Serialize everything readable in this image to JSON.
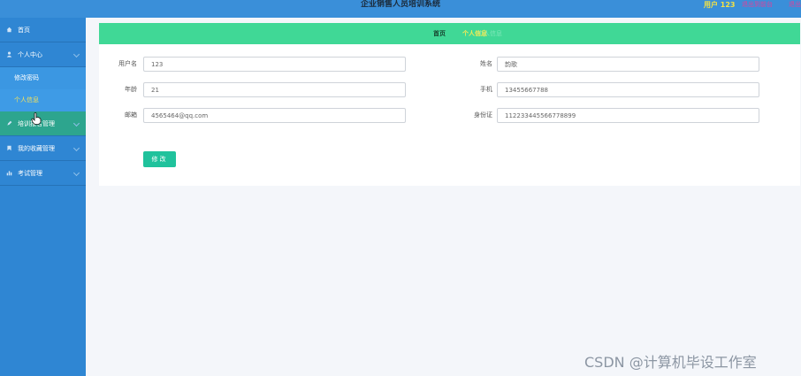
{
  "header": {
    "title": "企业销售人员培训系统",
    "user": "用户 123",
    "exit_link": "退出到前台",
    "logout_link": "退出"
  },
  "sidebar": {
    "items": [
      {
        "label": "首页",
        "icon": "home-icon"
      },
      {
        "label": "个人中心",
        "icon": "user-icon"
      },
      {
        "label": "培训报名管理",
        "icon": "pencil-icon"
      },
      {
        "label": "我的收藏管理",
        "icon": "bookmark-icon"
      },
      {
        "label": "考试管理",
        "icon": "bar-chart-icon"
      }
    ],
    "submenu": [
      {
        "label": "修改密码"
      },
      {
        "label": "个人信息"
      }
    ]
  },
  "breadcrumb": {
    "home": "首页",
    "current": "个人信息",
    "ghost": "个人信息"
  },
  "form": {
    "username_label": "用户名",
    "username": "123",
    "name_label": "姓名",
    "name": "韵歌",
    "age_label": "年龄",
    "age": "21",
    "phone_label": "手机",
    "phone": "13455667788",
    "email_label": "邮箱",
    "email": "4565464@qq.com",
    "idcard_label": "身份证",
    "idcard": "112233445566778899",
    "submit_label": "修改"
  },
  "watermark": "CSDN @计算机毕设工作室",
  "colors": {
    "topbar": "#3a8fd9",
    "sidebar": "#2f86d3",
    "active_menu": "#2da58e",
    "breadcrumb_bar": "#40d896",
    "button": "#20c29c",
    "highlight_text": "#f6e25a"
  }
}
